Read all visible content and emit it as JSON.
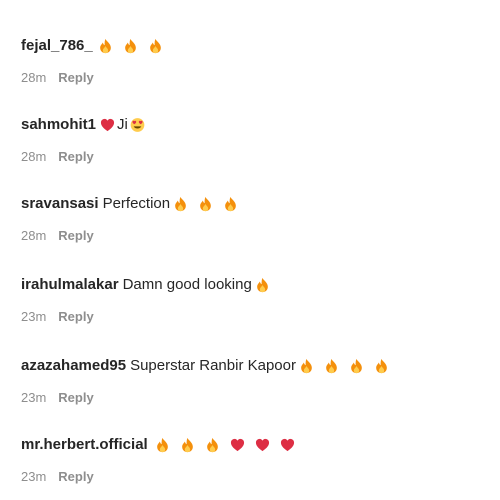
{
  "comments": [
    {
      "username": "fejal_786_",
      "text": "",
      "emojis": [
        "fire",
        "fire",
        "fire"
      ],
      "time": "28m",
      "reply": "Reply"
    },
    {
      "username": "sahmohit1",
      "text": "Ji",
      "emojis_before": [
        "heart"
      ],
      "emojis": [
        "heart-eyes-face"
      ],
      "time": "28m",
      "reply": "Reply"
    },
    {
      "username": "sravansasi",
      "text": "Perfection",
      "emojis": [
        "fire",
        "fire",
        "fire"
      ],
      "time": "28m",
      "reply": "Reply"
    },
    {
      "username": "irahulmalakar",
      "text": "Damn good looking",
      "emojis": [
        "fire"
      ],
      "time": "23m",
      "reply": "Reply"
    },
    {
      "username": "azazahamed95",
      "text": "Superstar Ranbir Kapoor",
      "emojis": [
        "fire",
        "fire",
        "fire",
        "fire"
      ],
      "time": "23m",
      "reply": "Reply"
    },
    {
      "username": "mr.herbert.official",
      "text": "",
      "emojis": [
        "fire",
        "fire",
        "fire",
        "heart",
        "heart",
        "heart"
      ],
      "time": "23m",
      "reply": "Reply"
    }
  ],
  "colors": {
    "text": "#262626",
    "meta": "#8e8e8e",
    "fire_outer": "#f4900c",
    "fire_inner": "#ffcc4d",
    "heart": "#dd2e44",
    "face": "#ffcc4d"
  }
}
